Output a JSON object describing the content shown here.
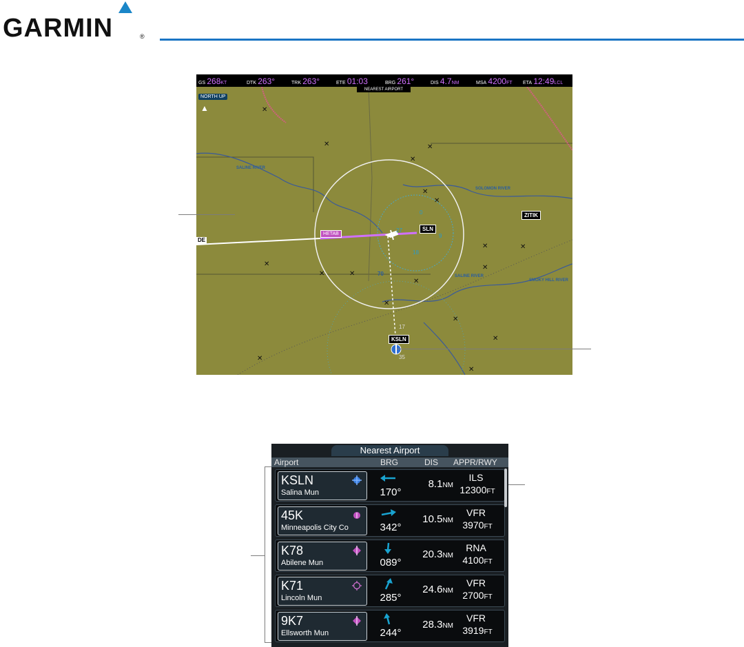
{
  "brand": {
    "name": "GARMIN",
    "registered": "®"
  },
  "colors": {
    "brand_blue": "#1a75c4",
    "magenta": "#d070ff",
    "map_terrain": "#8c8a3c",
    "cyan": "#19a3d0"
  },
  "map": {
    "topbar": [
      {
        "label": "GS",
        "value": "268",
        "unit": "KT"
      },
      {
        "label": "DTK",
        "value": "263°",
        "unit": ""
      },
      {
        "label": "TRK",
        "value": "263°",
        "unit": ""
      },
      {
        "label": "ETE",
        "value": "01:03",
        "unit": ""
      },
      {
        "label": "BRG",
        "value": "261°",
        "unit": ""
      },
      {
        "label": "DIS",
        "value": "4.7",
        "unit": "NM"
      },
      {
        "label": "MSA",
        "value": "4200",
        "unit": "FT"
      },
      {
        "label": "ETA",
        "value": "12:49",
        "unit": "LCL"
      }
    ],
    "page_label": "NEAREST AIRPORT",
    "orientation": "NORTH UP",
    "waypoints": {
      "hetab": "HETAB",
      "sln": "SLN",
      "zitik": "ZITIK",
      "ksln": "KSLN",
      "de": "DE"
    },
    "rivers": [
      "SALINE RIVER",
      "SOLOMON RIVER",
      "SALINE RIVER",
      "SMOKY HILL RIVER"
    ],
    "route_marker": "70",
    "ksln_runways": [
      "17",
      "35"
    ],
    "compass_labels": [
      "0",
      "27",
      "9",
      "18"
    ]
  },
  "nearest_airport": {
    "title": "Nearest Airport",
    "headers": {
      "airport": "Airport",
      "brg": "BRG",
      "dis": "DIS",
      "appr": "APPR/RWY"
    },
    "rows": [
      {
        "id": "KSLN",
        "name": "Salina Mun",
        "icon": "towered-airport-icon",
        "brg": "170°",
        "dis": "8.1",
        "dis_unit": "NM",
        "appr": "ILS",
        "rwy": "12300",
        "rwy_unit": "FT"
      },
      {
        "id": "45K",
        "name": "Minneapolis City Co",
        "icon": "non-towered-airport-icon",
        "brg": "342°",
        "dis": "10.5",
        "dis_unit": "NM",
        "appr": "VFR",
        "rwy": "3970",
        "rwy_unit": "FT"
      },
      {
        "id": "K78",
        "name": "Abilene Mun",
        "icon": "non-towered-airport-icon",
        "brg": "089°",
        "dis": "20.3",
        "dis_unit": "NM",
        "appr": "RNA",
        "rwy": "4100",
        "rwy_unit": "FT"
      },
      {
        "id": "K71",
        "name": "Lincoln Mun",
        "icon": "unpaved-airport-icon",
        "brg": "285°",
        "dis": "24.6",
        "dis_unit": "NM",
        "appr": "VFR",
        "rwy": "2700",
        "rwy_unit": "FT"
      },
      {
        "id": "9K7",
        "name": "Ellsworth Mun",
        "icon": "non-towered-airport-icon",
        "brg": "244°",
        "dis": "28.3",
        "dis_unit": "NM",
        "appr": "VFR",
        "rwy": "3919",
        "rwy_unit": "FT"
      }
    ]
  }
}
